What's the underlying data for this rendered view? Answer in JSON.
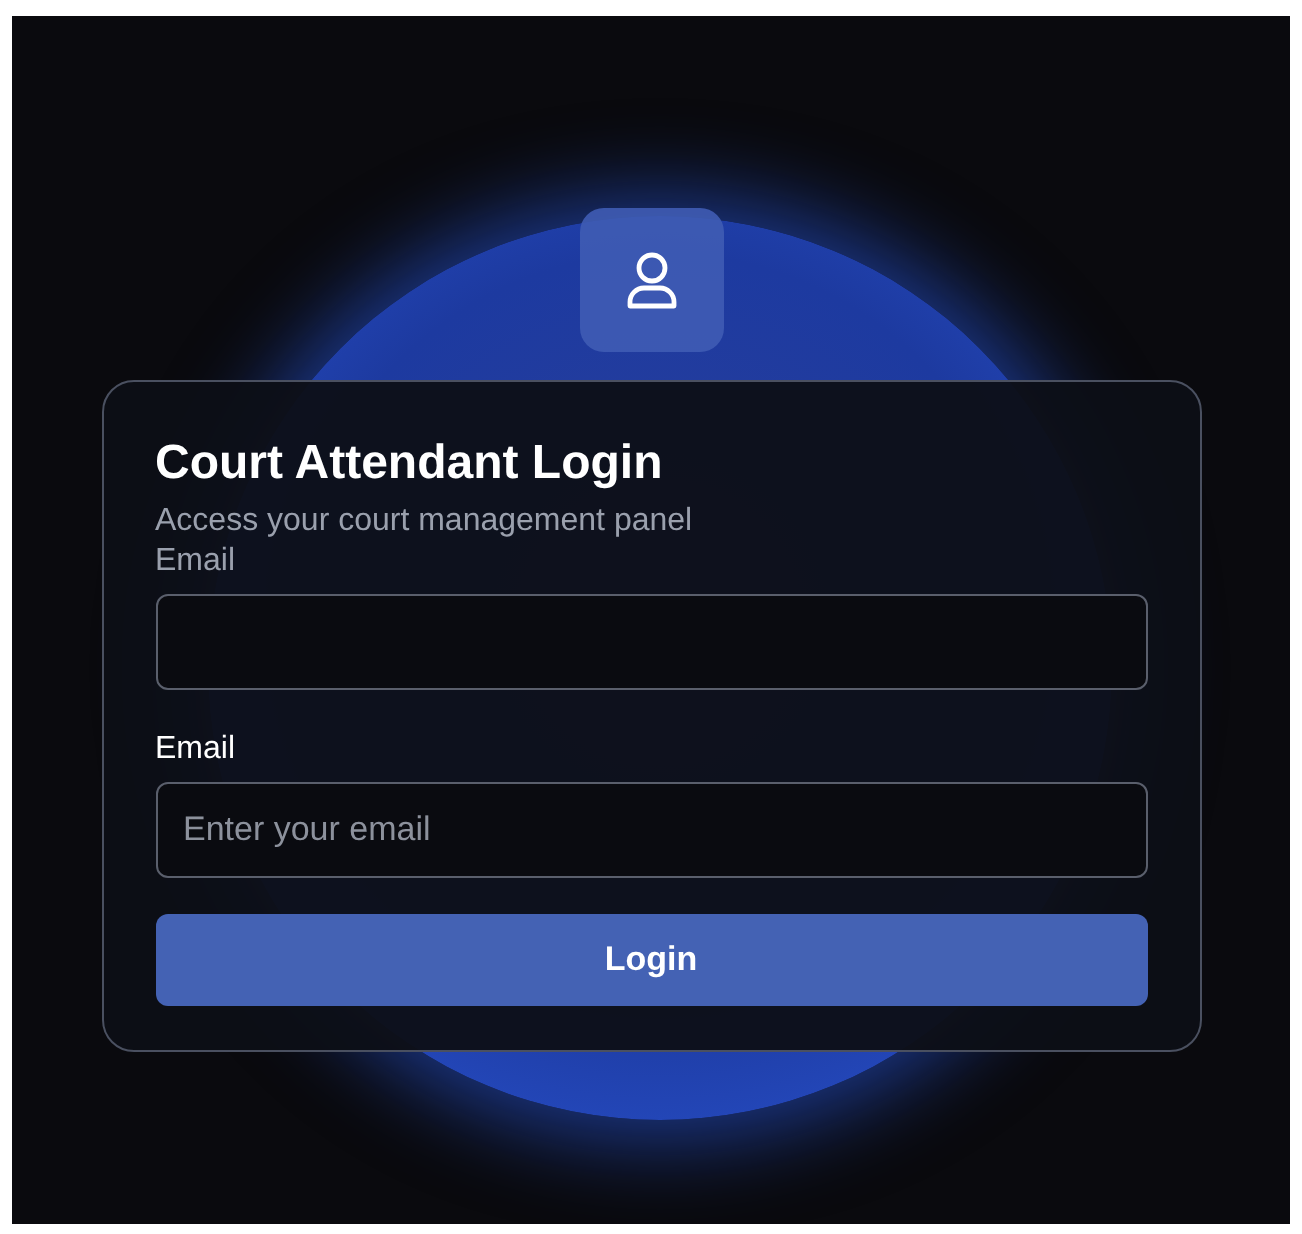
{
  "card": {
    "title": "Court Attendant Login",
    "subtitle": "Access your court management panel"
  },
  "fields": [
    {
      "label": "Email",
      "kind": "muted"
    },
    {
      "label": "Email",
      "kind": "strong",
      "placeholder": "Enter your email"
    }
  ],
  "button": {
    "label": "Login"
  }
}
